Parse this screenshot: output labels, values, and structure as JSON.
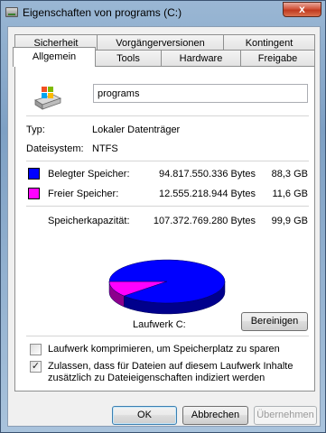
{
  "window": {
    "title": "Eigenschaften von programs (C:)",
    "close_glyph": "x"
  },
  "tabs": {
    "row1": [
      "Sicherheit",
      "Vorgängerversionen",
      "Kontingent"
    ],
    "row2": [
      "Allgemein",
      "Tools",
      "Hardware",
      "Freigabe"
    ],
    "active": "Allgemein"
  },
  "general": {
    "name_value": "programs",
    "type_label": "Typ:",
    "type_value": "Lokaler Datenträger",
    "fs_label": "Dateisystem:",
    "fs_value": "NTFS",
    "used_label": "Belegter Speicher:",
    "used_bytes": "94.817.550.336 Bytes",
    "used_gb": "88,3 GB",
    "free_label": "Freier Speicher:",
    "free_bytes": "12.555.218.944 Bytes",
    "free_gb": "11,6 GB",
    "capacity_label": "Speicherkapazität:",
    "capacity_bytes": "107.372.769.280 Bytes",
    "capacity_gb": "99,9 GB",
    "drive_label": "Laufwerk C:",
    "cleanup_button": "Bereinigen",
    "compress_label": "Laufwerk komprimieren, um Speicherplatz zu sparen",
    "compress_checked": false,
    "index_label_line1": "Zulassen, dass für Dateien auf diesem Laufwerk Inhalte",
    "index_label_line2": "zusätzlich zu Dateieigenschaften indiziert werden",
    "index_checked": true
  },
  "colors": {
    "used": "#0000ff",
    "free": "#ff00ff"
  },
  "chart_data": {
    "type": "pie",
    "categories": [
      "Belegter Speicher",
      "Freier Speicher"
    ],
    "values": [
      94817550336,
      12555218944
    ]
  },
  "buttons": {
    "ok": "OK",
    "cancel": "Abbrechen",
    "apply": "Übernehmen"
  }
}
